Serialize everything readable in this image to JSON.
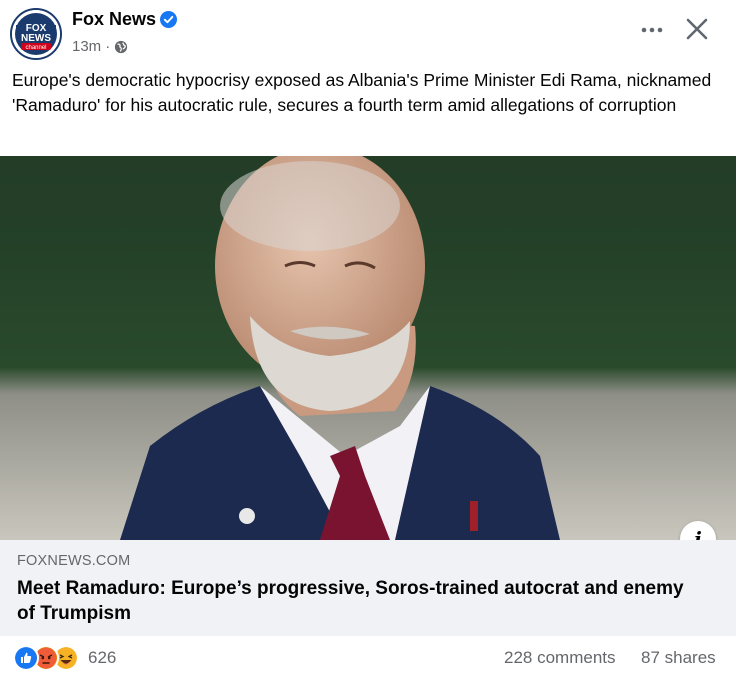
{
  "post": {
    "page_name": "Fox News",
    "time": "13m",
    "separator": "·",
    "text": "Europe's democratic hypocrisy exposed as Albania's Prime Minister Edi Rama, nicknamed 'Ramaduro' for his autocratic rule, secures a fourth term amid allegations of corruption",
    "avatar_logo_lines": [
      "FOX",
      "NEWS",
      "channel"
    ]
  },
  "link": {
    "domain": "FOXNEWS.COM",
    "title": "Meet Ramaduro: Europe’s progressive, Soros-trained autocrat and enemy of Trumpism"
  },
  "engagement": {
    "reaction_count": "626",
    "comments": "228 comments",
    "shares": "87 shares",
    "reaction_icons": [
      "like-icon",
      "angry-icon",
      "haha-icon"
    ]
  },
  "icons": {
    "verified": "verified-badge-icon",
    "privacy": "globe-icon",
    "more": "more-options-icon",
    "close": "close-icon",
    "info": "info-icon",
    "info_glyph": "i"
  },
  "colors": {
    "brand_blue": "#1877f2",
    "secondary_text": "#65676b",
    "link_bg": "#f0f2f5"
  }
}
